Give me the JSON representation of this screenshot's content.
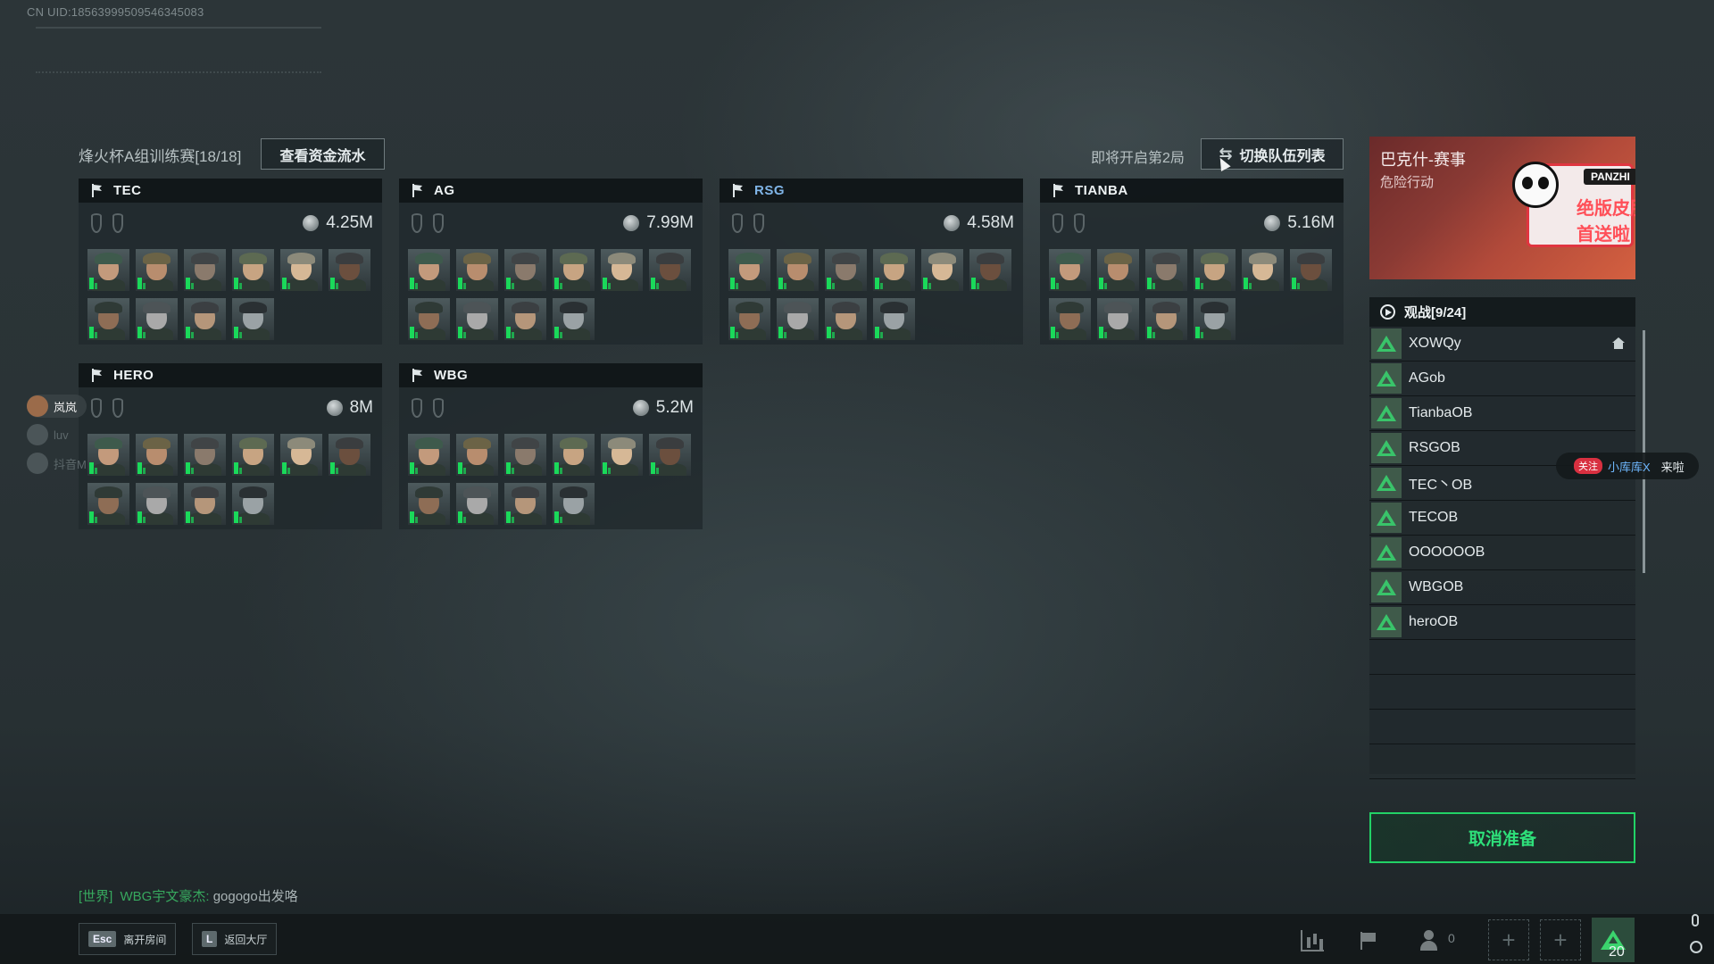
{
  "uid": "CN UID:18563999509546345083",
  "header": {
    "match_title": "烽火杯A组训练赛[18/18]",
    "fund_button": "查看资金流水",
    "next_round": "即将开启第2局",
    "switch_button": "切换队伍列表"
  },
  "teams": [
    {
      "name": "TEC",
      "money": "4.25M"
    },
    {
      "name": "AG",
      "money": "7.99M"
    },
    {
      "name": "RSG",
      "money": "4.58M"
    },
    {
      "name": "TIANBA",
      "money": "5.16M"
    },
    {
      "name": "HERO",
      "money": "8M"
    },
    {
      "name": "WBG",
      "money": "5.2M"
    }
  ],
  "streamer_card": {
    "title": "巴克什-赛事",
    "subtitle": "危险行动",
    "tag": "PANZHI",
    "slogan": "绝版皮肤 首送啦"
  },
  "spectators": {
    "title": "观战[9/24]",
    "list": [
      "XOWQy",
      "AGob",
      "TianbaOB",
      "RSGOB",
      "TEC丶OB",
      "TECOB",
      "OOOOOOB",
      "WBGOB",
      "heroOB"
    ]
  },
  "follow_popup": {
    "badge": "关注",
    "user": "小库库X",
    "action": "来啦"
  },
  "viewers": [
    "岚岚",
    "luv",
    "抖音M"
  ],
  "cancel_button": "取消准备",
  "chat": {
    "channel": "[世界]",
    "sender": "WBG宇文豪杰:",
    "message": "gogogo出发咯"
  },
  "bottom_bar": {
    "esc_key": "Esc",
    "leave_room": "离开房间",
    "l_key": "L",
    "back_lobby": "返回大厅",
    "friends_count": "0",
    "level": "20"
  },
  "colors": {
    "accent_green": "#22d266",
    "highlight_team": "#7fb4e6",
    "health_green": "#1ad95a"
  }
}
